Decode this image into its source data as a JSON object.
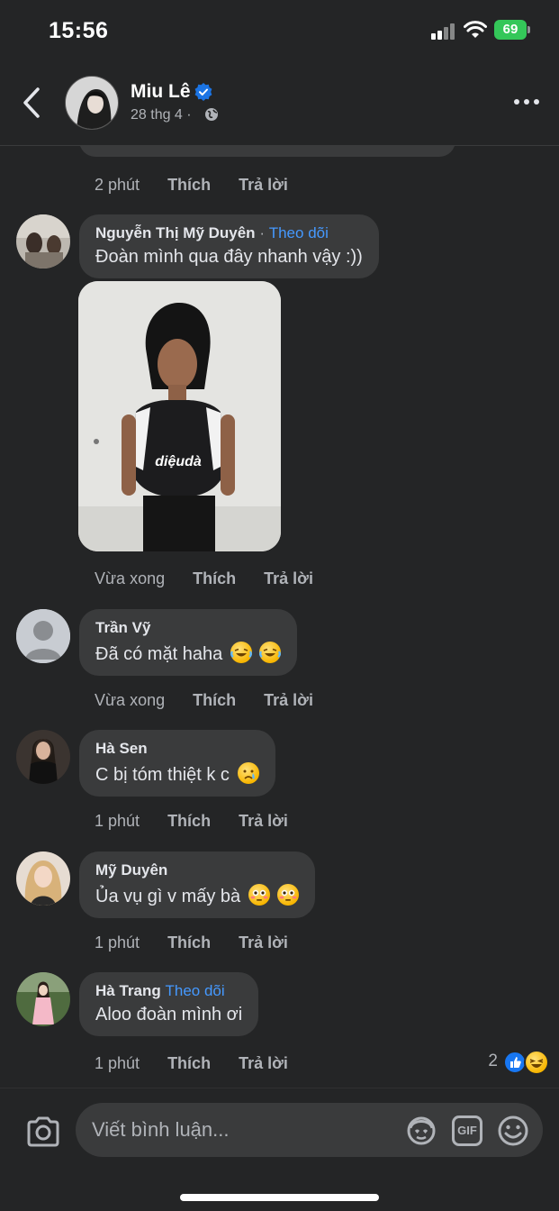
{
  "status_bar": {
    "time": "15:56",
    "battery": "69"
  },
  "header": {
    "name": "Miu Lê",
    "subtitle": "28 thg 4 ·"
  },
  "previous_comment_actions": {
    "time": "2 phút",
    "like": "Thích",
    "reply": "Trả lời"
  },
  "comments": [
    {
      "name": "Nguyễn Thị Mỹ Duyên",
      "separator": "·",
      "follow": "Theo dõi",
      "text": "Đoàn mình qua đây nhanh vậy :))",
      "photo_text": "diệudà",
      "time": "Vừa xong",
      "like": "Thích",
      "reply": "Trả lời"
    },
    {
      "name": "Trần Vỹ",
      "text": "Đã có mặt haha",
      "time": "Vừa xong",
      "like": "Thích",
      "reply": "Trả lời"
    },
    {
      "name": "Hà Sen",
      "text": "C bị tóm thiệt k c",
      "time": "1 phút",
      "like": "Thích",
      "reply": "Trả lời"
    },
    {
      "name": "Mỹ Duyên",
      "text": "Ủa vụ gì v mấy bà",
      "time": "1 phút",
      "like": "Thích",
      "reply": "Trả lời"
    },
    {
      "name": "Hà Trang",
      "follow": "Theo dõi",
      "text": "Aloo đoàn mình ơi",
      "time": "1 phút",
      "like": "Thích",
      "reply": "Trả lời",
      "reaction_count": "2"
    }
  ],
  "composer": {
    "placeholder": "Viết bình luận...",
    "gif_label": "GIF"
  },
  "colors": {
    "background": "#242526",
    "bubble": "#3a3b3c",
    "link": "#4599ff",
    "battery": "#34c759"
  },
  "icons": [
    "back-icon",
    "verified-icon",
    "globe-icon",
    "more-icon",
    "camera-icon",
    "avatar-sticker-icon",
    "gif-icon",
    "sticker-icon",
    "like-icon",
    "haha-icon"
  ]
}
